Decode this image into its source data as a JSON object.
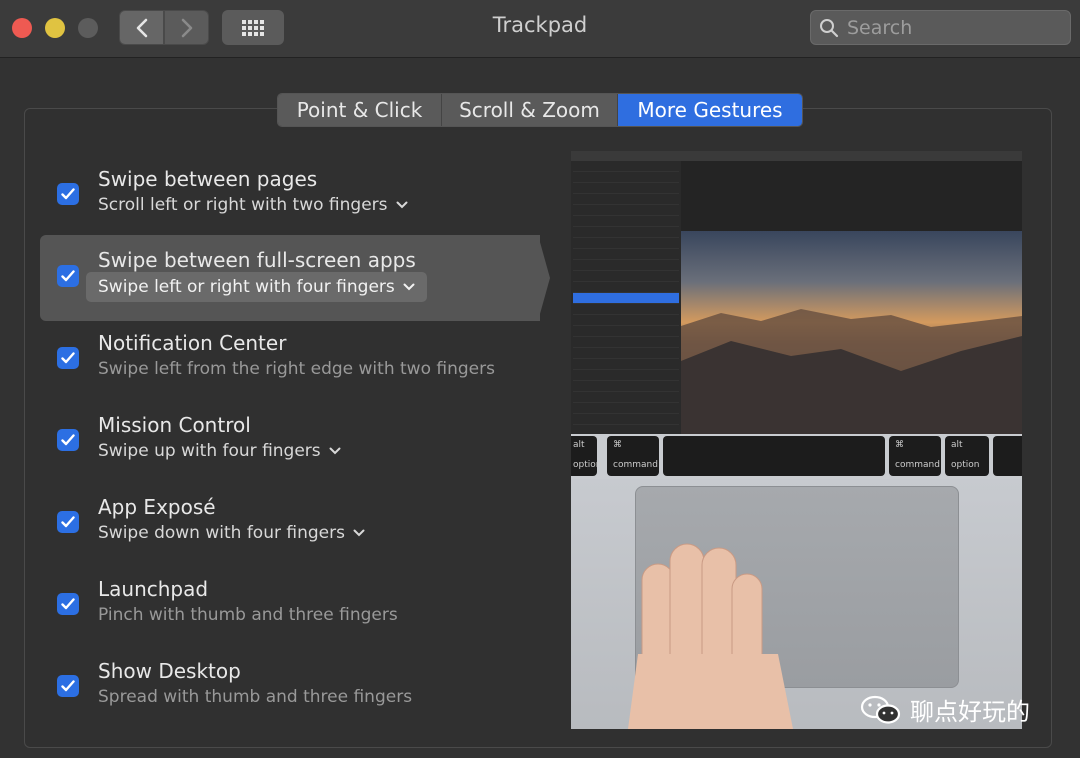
{
  "window": {
    "title": "Trackpad"
  },
  "search": {
    "placeholder": "Search"
  },
  "tabs": [
    {
      "label": "Point & Click",
      "active": false
    },
    {
      "label": "Scroll & Zoom",
      "active": false
    },
    {
      "label": "More Gestures",
      "active": true
    }
  ],
  "gestures": [
    {
      "title": "Swipe between pages",
      "subtitle": "Scroll left or right with two fingers",
      "checked": true,
      "has_menu": true
    },
    {
      "title": "Swipe between full-screen apps",
      "subtitle": "Swipe left or right with four fingers",
      "checked": true,
      "has_menu": true,
      "selected": true
    },
    {
      "title": "Notification Center",
      "subtitle": "Swipe left from the right edge with two fingers",
      "checked": true,
      "has_menu": false
    },
    {
      "title": "Mission Control",
      "subtitle": "Swipe up with four fingers",
      "checked": true,
      "has_menu": true
    },
    {
      "title": "App Exposé",
      "subtitle": "Swipe down with four fingers",
      "checked": true,
      "has_menu": true
    },
    {
      "title": "Launchpad",
      "subtitle": "Pinch with thumb and three fingers",
      "checked": true,
      "has_menu": false
    },
    {
      "title": "Show Desktop",
      "subtitle": "Spread with thumb and three fingers",
      "checked": true,
      "has_menu": false
    }
  ],
  "preview": {
    "keys": [
      {
        "top": "alt",
        "bottom": "option"
      },
      {
        "top": "⌘",
        "bottom": "command"
      },
      {
        "top": "⌘",
        "bottom": "command"
      },
      {
        "top": "alt",
        "bottom": "option"
      }
    ]
  },
  "watermark": {
    "text": "聊点好玩的"
  },
  "colors": {
    "accent": "#2f6ee0",
    "background": "#323232"
  }
}
